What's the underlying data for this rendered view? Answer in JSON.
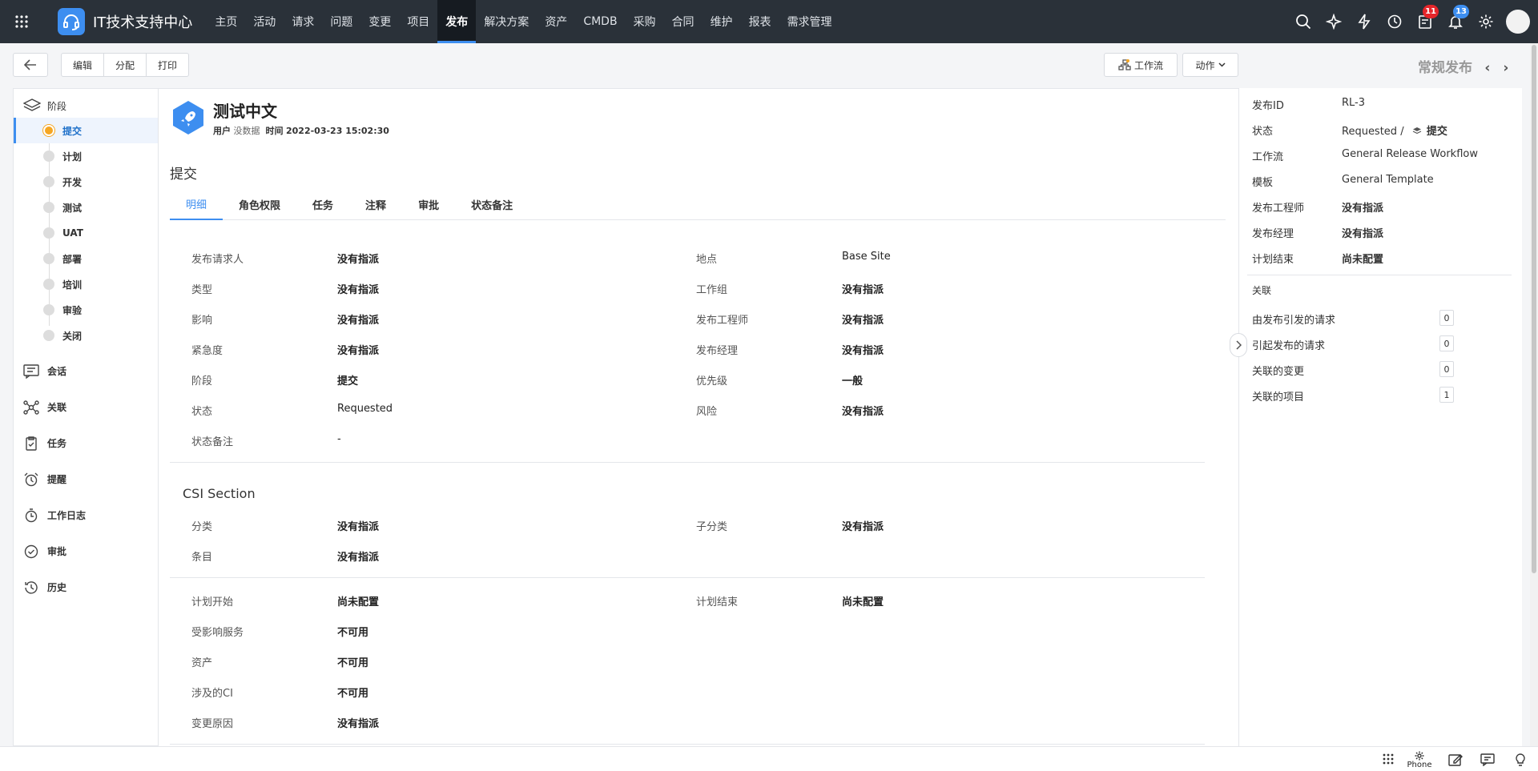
{
  "app": {
    "title": "IT技术支持中心"
  },
  "nav": {
    "items": [
      "主页",
      "活动",
      "请求",
      "问题",
      "变更",
      "项目",
      "发布",
      "解决方案",
      "资产",
      "CMDB",
      "采购",
      "合同",
      "维护",
      "报表",
      "需求管理"
    ],
    "active_index": 6
  },
  "header": {
    "notifications_badge": "11",
    "alerts_badge": "13",
    "icons": [
      "search-icon",
      "sparkle-icon",
      "lightning-icon",
      "history-icon",
      "checklist-icon",
      "bell-icon",
      "gear-icon"
    ]
  },
  "toolbar": {
    "edit_label": "编辑",
    "assign_label": "分配",
    "print_label": "打印",
    "workflow_label": "工作流",
    "actions_label": "动作",
    "panel_title": "常规发布"
  },
  "phases": {
    "header": "阶段",
    "items": [
      "提交",
      "计划",
      "开发",
      "测试",
      "UAT",
      "部署",
      "培训",
      "审验",
      "关闭"
    ],
    "active_index": 0
  },
  "sidelinks": [
    "会话",
    "关联",
    "任务",
    "提醒",
    "工作日志",
    "审批",
    "历史"
  ],
  "record": {
    "title": "测试中文",
    "user_label": "用户",
    "user_value": "没数据",
    "time_label": "时间",
    "time_value": "2022-03-23 15:02:30",
    "section": "提交"
  },
  "tabs": [
    "明细",
    "角色权限",
    "任务",
    "注释",
    "审批",
    "状态备注"
  ],
  "details_left": [
    {
      "k": "发布请求人",
      "v": "没有指派"
    },
    {
      "k": "类型",
      "v": "没有指派"
    },
    {
      "k": "影响",
      "v": "没有指派"
    },
    {
      "k": "紧急度",
      "v": "没有指派"
    },
    {
      "k": "阶段",
      "v": "提交"
    },
    {
      "k": "状态",
      "v": "Requested"
    },
    {
      "k": "状态备注",
      "v": "-"
    }
  ],
  "details_right": [
    {
      "k": "地点",
      "v": "Base Site"
    },
    {
      "k": "工作组",
      "v": "没有指派"
    },
    {
      "k": "发布工程师",
      "v": "没有指派"
    },
    {
      "k": "发布经理",
      "v": "没有指派"
    },
    {
      "k": "优先级",
      "v": "一般"
    },
    {
      "k": "风险",
      "v": "没有指派"
    }
  ],
  "csi": {
    "title": "CSI Section",
    "category_label": "分类",
    "category_value": "没有指派",
    "subcategory_label": "子分类",
    "subcategory_value": "没有指派",
    "item_label": "条目",
    "item_value": "没有指派"
  },
  "schedule": {
    "plan_start_label": "计划开始",
    "plan_start_value": "尚未配置",
    "plan_end_label": "计划结束",
    "plan_end_value": "尚未配置",
    "services_label": "受影响服务",
    "services_value": "不可用",
    "assets_label": "资产",
    "assets_value": "不可用",
    "ci_label": "涉及的CI",
    "ci_value": "不可用",
    "reason_label": "变更原因",
    "reason_value": "没有指派"
  },
  "right_panel": {
    "rows": [
      {
        "k": "发布ID",
        "v": "RL-3"
      },
      {
        "k": "状态",
        "v": "Requested /"
      },
      {
        "k": "工作流",
        "v": "General Release Workflow"
      },
      {
        "k": "模板",
        "v": "General Template"
      },
      {
        "k": "发布工程师",
        "v": "没有指派"
      },
      {
        "k": "发布经理",
        "v": "没有指派"
      },
      {
        "k": "计划结束",
        "v": "尚未配置"
      }
    ],
    "status_phase": "提交",
    "relations_title": "关联",
    "relations": [
      {
        "k": "由发布引发的请求",
        "v": "0"
      },
      {
        "k": "引起发布的请求",
        "v": "0"
      },
      {
        "k": "关联的变更",
        "v": "0"
      },
      {
        "k": "关联的项目",
        "v": "1"
      }
    ]
  },
  "bottombar": {
    "phone_label": "Phone"
  }
}
